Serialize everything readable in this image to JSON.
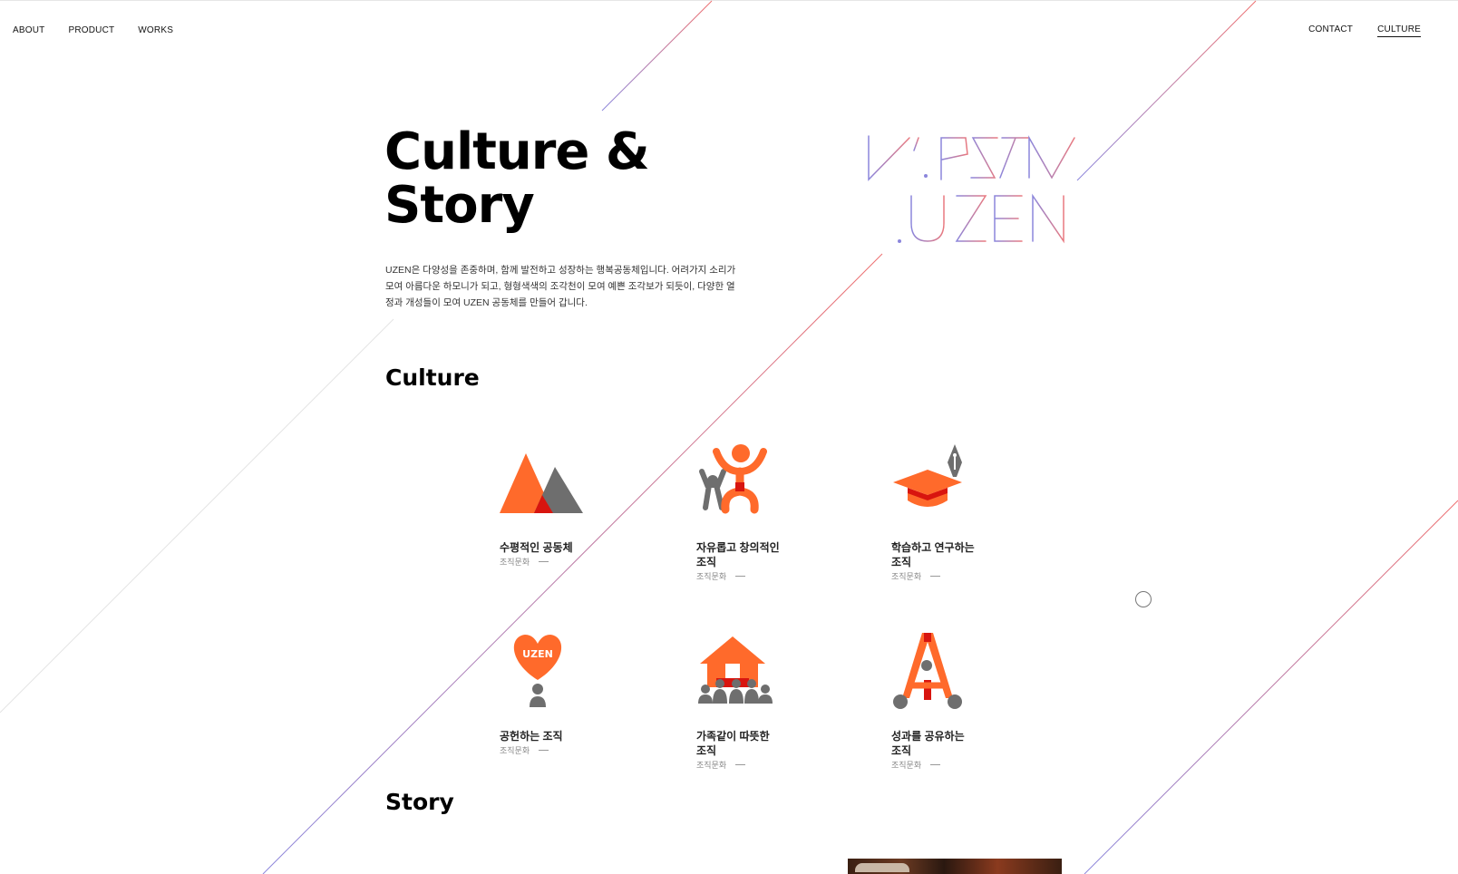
{
  "nav": {
    "left": [
      "ABOUT",
      "PRODUCT",
      "WORKS"
    ],
    "right": [
      "CONTACT",
      "CULTURE"
    ],
    "active": "CULTURE"
  },
  "hero": {
    "title_line1": "Culture &",
    "title_line2": "Story",
    "description": "UZEN은 다양성을 존중하며, 함께 발전하고 성장하는 행복공동체입니다. 어려가지 소리가 모여 아름다운 하모니가 되고, 형형색색의 조각천이 모여 예쁜 조각보가 되듯이, 다양한 열정과 개성들이 모여 UZEN 공동체를 만들어 갑니다."
  },
  "logo": {
    "top_text": "V'.PSTN",
    "bottom_text": ".UZEN",
    "colors": [
      "#8b86dc",
      "#e9797f"
    ]
  },
  "sections": {
    "culture": "Culture",
    "story": "Story"
  },
  "culture_items": [
    {
      "name": "수평적인 공동체",
      "category": "조직문화",
      "icon": "triangles-icon"
    },
    {
      "name": "자유롭고 창의적인\n조직",
      "category": "조직문화",
      "icon": "people-jumping-icon"
    },
    {
      "name": "학습하고 연구하는\n조직",
      "category": "조직문화",
      "icon": "graduation-cap-pen-icon"
    },
    {
      "name": "공헌하는 조직",
      "category": "조직문화",
      "icon": "heart-uzen-icon"
    },
    {
      "name": "가족같이 따뜻한\n조직",
      "category": "조직문화",
      "icon": "house-family-icon"
    },
    {
      "name": "성과를 공유하는\n조직",
      "category": "조직문화",
      "icon": "share-a-icon"
    }
  ],
  "heart_label": "UZEN",
  "colors": {
    "orange": "#ff6a2b",
    "red": "#d8150f",
    "gray": "#6e6e6e",
    "line_purple": "#8b86dc",
    "line_red": "#ee7070"
  }
}
